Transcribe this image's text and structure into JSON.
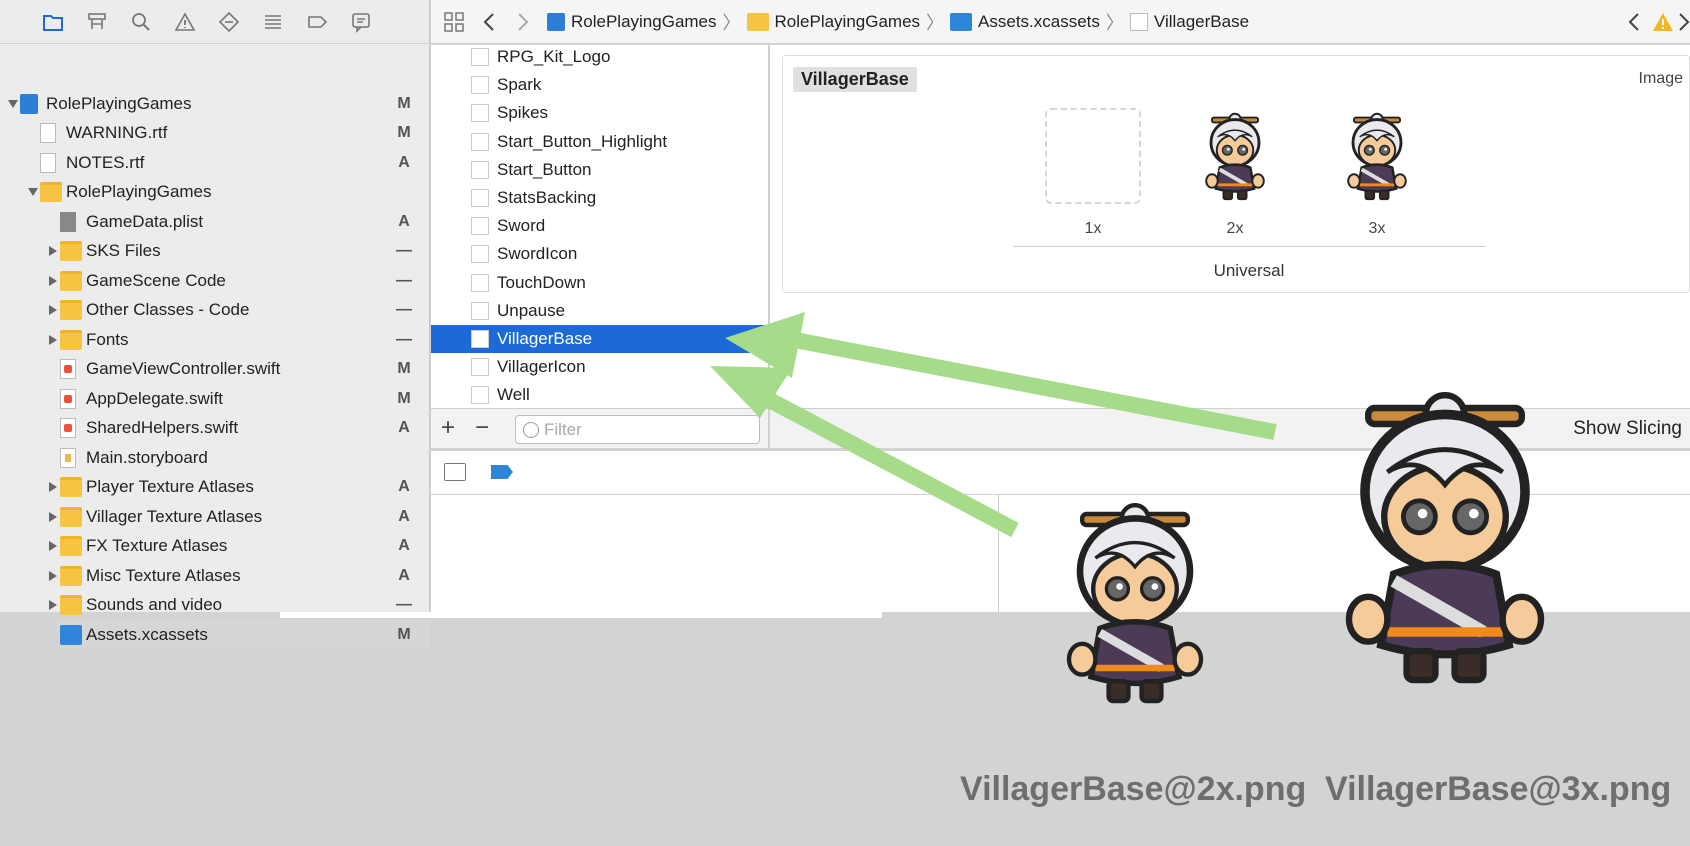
{
  "navigator": {
    "toolbar_icons": [
      "folder-icon",
      "hierarchy-icon",
      "search-icon",
      "warning-icon",
      "test-icon",
      "debug-icon",
      "breakpoint-icon",
      "report-icon"
    ],
    "items": [
      {
        "label": "RolePlayingGames",
        "status": "M",
        "icon": "project-icon"
      },
      {
        "label": "WARNING.rtf",
        "status": "M",
        "icon": "document-icon"
      },
      {
        "label": "NOTES.rtf",
        "status": "A",
        "icon": "document-icon"
      },
      {
        "label": "RolePlayingGames",
        "status": "",
        "icon": "folder-icon"
      },
      {
        "label": "GameData.plist",
        "status": "A",
        "icon": "plist-icon"
      },
      {
        "label": "SKS Files",
        "status": "—",
        "icon": "folder-icon"
      },
      {
        "label": "GameScene Code",
        "status": "—",
        "icon": "folder-icon"
      },
      {
        "label": "Other Classes - Code",
        "status": "—",
        "icon": "folder-icon"
      },
      {
        "label": "Fonts",
        "status": "—",
        "icon": "folder-icon"
      },
      {
        "label": "GameViewController.swift",
        "status": "M",
        "icon": "swift-file-icon"
      },
      {
        "label": "AppDelegate.swift",
        "status": "M",
        "icon": "swift-file-icon"
      },
      {
        "label": "SharedHelpers.swift",
        "status": "A",
        "icon": "swift-file-icon"
      },
      {
        "label": "Main.storyboard",
        "status": "",
        "icon": "storyboard-icon"
      },
      {
        "label": "Player Texture Atlases",
        "status": "A",
        "icon": "folder-icon"
      },
      {
        "label": "Villager Texture Atlases",
        "status": "A",
        "icon": "folder-icon"
      },
      {
        "label": "FX Texture Atlases",
        "status": "A",
        "icon": "folder-icon"
      },
      {
        "label": "Misc Texture Atlases",
        "status": "A",
        "icon": "folder-icon"
      },
      {
        "label": "Sounds and video",
        "status": "—",
        "icon": "folder-icon"
      },
      {
        "label": "Assets.xcassets",
        "status": "M",
        "icon": "xcassets-icon"
      }
    ]
  },
  "jumpbar": {
    "crumbs": [
      "RolePlayingGames",
      "RolePlayingGames",
      "Assets.xcassets",
      "VillagerBase"
    ]
  },
  "assets": {
    "items": [
      "RPG_Kit_Logo",
      "Spark",
      "Spikes",
      "Start_Button_Highlight",
      "Start_Button",
      "StatsBacking",
      "Sword",
      "SwordIcon",
      "TouchDown",
      "Unpause",
      "VillagerBase",
      "VillagerIcon",
      "Well"
    ],
    "selected": "VillagerBase",
    "filter_placeholder": "Filter"
  },
  "detail": {
    "title": "VillagerBase",
    "type": "Image",
    "slots": [
      "1x",
      "2x",
      "3x"
    ],
    "group": "Universal"
  },
  "show_slicing": "Show Slicing",
  "annotation": {
    "file_2x": "VillagerBase@2x.png",
    "file_3x": "VillagerBase@3x.png",
    "arrow_color": "#a6db8a"
  },
  "colors": {
    "selection": "#1b6ad6",
    "folder": "#f6c443",
    "warning": "#f2b821"
  }
}
